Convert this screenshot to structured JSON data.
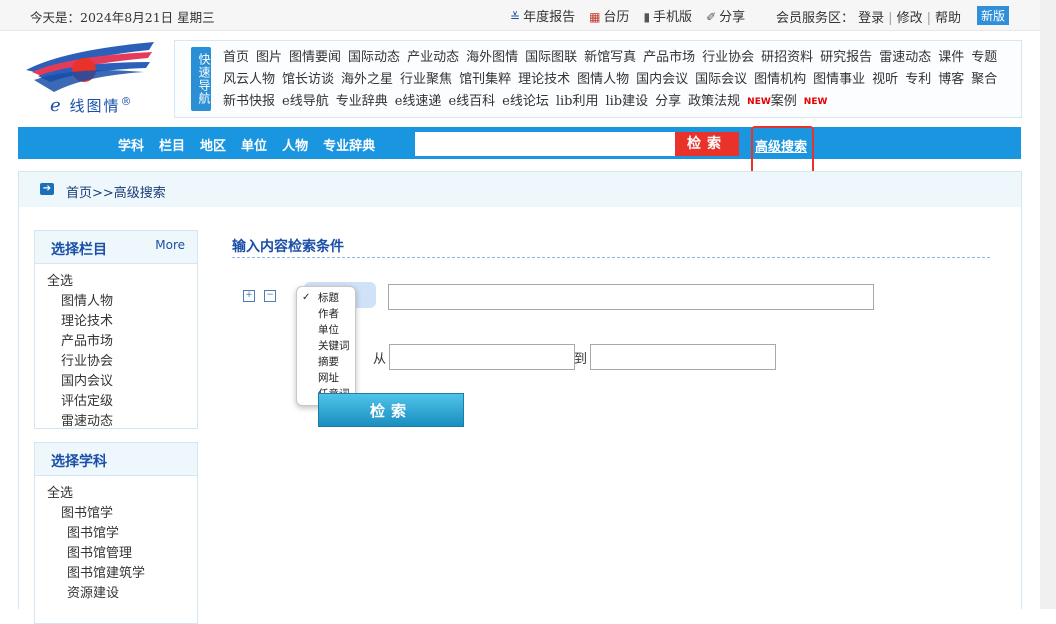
{
  "topbar": {
    "date": "今天是：2024年8月21日 星期三",
    "links": [
      "年度报告",
      "台历",
      "手机版",
      "分享"
    ],
    "member_label": "会员服务区：",
    "member_links": [
      "登录",
      "修改",
      "帮助"
    ],
    "new_badge": "新版"
  },
  "logo": {
    "e": "e",
    "text": "线图情",
    "reg": "®"
  },
  "quicknav": {
    "title": "快速导航",
    "links": [
      "首页",
      "图片",
      "图情要闻",
      "国际动态",
      "产业动态",
      "海外图情",
      "国际图联",
      "新馆写真",
      "产品市场",
      "行业协会",
      "研招资料",
      "研究报告",
      "雷速动态",
      "课件",
      "专题",
      "风云人物",
      "馆长访谈",
      "海外之星",
      "行业聚焦",
      "馆刊集粹",
      "理论技术",
      "图情人物",
      "国内会议",
      "国际会议",
      "图情机构",
      "图情事业",
      "视听",
      "专利",
      "博客",
      "聚合",
      "新书快报",
      "e线导航",
      "专业辞典",
      "e线速递",
      "e线百科",
      "e线论坛",
      "lib利用",
      "lib建设",
      "分享",
      "政策法规",
      "案例"
    ],
    "new_tag": "NEW"
  },
  "navbar": {
    "items": [
      "学科",
      "栏目",
      "地区",
      "单位",
      "人物",
      "专业辞典"
    ],
    "search_value": "",
    "search_button": "检索",
    "advanced": "高级搜索"
  },
  "breadcrumb": "首页>>高级搜索",
  "panel_column": {
    "title": "选择栏目",
    "more": "More",
    "all": "全选",
    "items": [
      "图情人物",
      "理论技术",
      "产品市场",
      "行业协会",
      "国内会议",
      "评估定级",
      "雷速动态"
    ]
  },
  "panel_subject": {
    "title": "选择学科",
    "all": "全选",
    "group": "图书馆学",
    "items": [
      "图书馆学",
      "图书馆管理",
      "图书馆建筑学",
      "资源建设"
    ]
  },
  "main": {
    "title": "输入内容检索条件",
    "field_options": [
      "标题",
      "作者",
      "单位",
      "关键词",
      "摘要",
      "网址",
      "任意词"
    ],
    "selected_field": "标题",
    "from_label": "从",
    "to_label": "到",
    "search_button": "检索"
  },
  "colors": {
    "nav_blue": "#1a95e0",
    "search_red": "#e8322a",
    "link_blue": "#1a4fa8"
  }
}
